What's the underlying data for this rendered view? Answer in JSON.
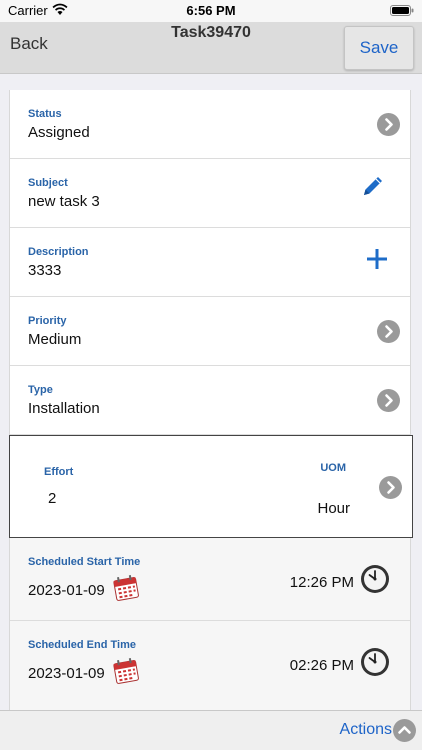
{
  "status_bar": {
    "carrier": "Carrier",
    "time": "6:56 PM",
    "icons": [
      "wifi-icon",
      "battery-icon"
    ]
  },
  "nav": {
    "back_label": "Back",
    "title": "Task39470",
    "save_label": "Save"
  },
  "fields": {
    "status": {
      "label": "Status",
      "value": "Assigned",
      "icon": "chevron-right-icon"
    },
    "subject": {
      "label": "Subject",
      "value": "new task 3",
      "icon": "pencil-icon"
    },
    "description": {
      "label": "Description",
      "value": "3333",
      "icon": "plus-icon"
    },
    "priority": {
      "label": "Priority",
      "value": "Medium",
      "icon": "chevron-right-icon"
    },
    "type": {
      "label": "Type",
      "value": "Installation",
      "icon": "chevron-right-icon"
    },
    "effort": {
      "label": "Effort",
      "value": "2",
      "uom_label": "UOM",
      "uom_value": "Hour"
    },
    "scheduled_start": {
      "label": "Scheduled Start Time",
      "date": "2023-01-09",
      "time": "12:26 PM"
    },
    "scheduled_end": {
      "label": "Scheduled End Time",
      "date": "2023-01-09",
      "time": "02:26 PM"
    }
  },
  "bottom": {
    "actions_label": "Actions"
  },
  "colors": {
    "accent": "#1e64c8",
    "label": "#2a64a8",
    "chevron": "#9a9a9a",
    "nav_bg": "#dcdcdc"
  }
}
